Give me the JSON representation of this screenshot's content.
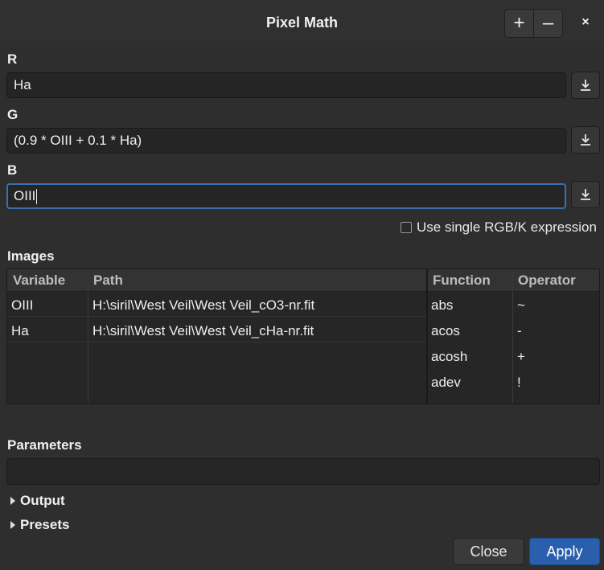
{
  "window": {
    "title": "Pixel Math"
  },
  "header_buttons": {
    "plus": "+",
    "minus": "–",
    "close": "×"
  },
  "channels": {
    "r": {
      "label": "R",
      "value": "Ha"
    },
    "g": {
      "label": "G",
      "value": "(0.9 * OIII + 0.1 * Ha)"
    },
    "b": {
      "label": "B",
      "value": "OIII"
    }
  },
  "single_rgb": {
    "label": "Use single RGB/K expression",
    "checked": false
  },
  "images": {
    "label": "Images",
    "columns": {
      "variable": "Variable",
      "path": "Path",
      "function": "Function",
      "operator": "Operator"
    },
    "rows": [
      {
        "variable": "OIII",
        "path": "H:\\siril\\West Veil\\West Veil_cO3-nr.fit"
      },
      {
        "variable": "Ha",
        "path": "H:\\siril\\West Veil\\West Veil_cHa-nr.fit"
      }
    ],
    "functions": [
      "abs",
      "acos",
      "acosh",
      "adev"
    ],
    "operators": [
      "~",
      "-",
      "+",
      "!"
    ]
  },
  "parameters": {
    "label": "Parameters",
    "value": ""
  },
  "expanders": {
    "output": "Output",
    "presets": "Presets"
  },
  "actions": {
    "close": "Close",
    "apply": "Apply"
  },
  "colors": {
    "accent": "#2a5fae",
    "focus_border": "#3a6fb0",
    "background": "#2e2e2e"
  },
  "icons": {
    "download": "download-icon",
    "expander": "triangle-right-icon"
  }
}
